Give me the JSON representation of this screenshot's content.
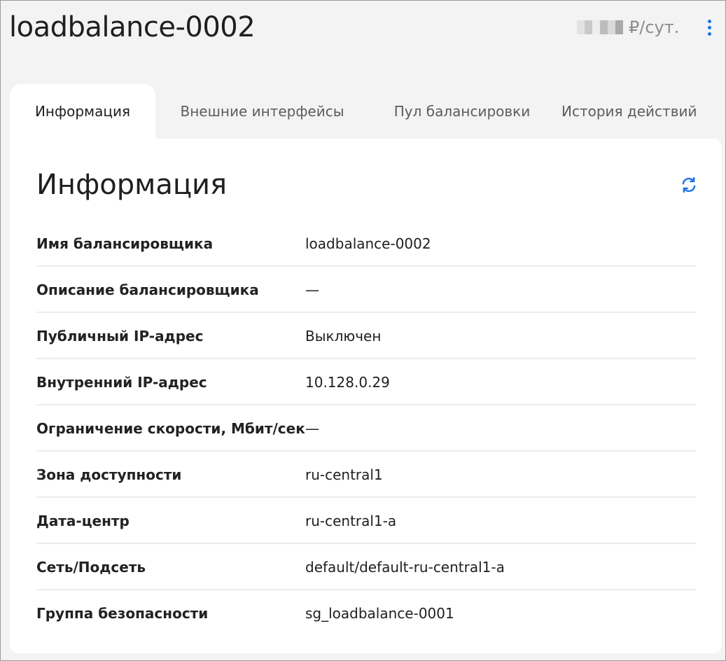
{
  "header": {
    "title": "loadbalance-0002",
    "price_unit": "₽/сут.",
    "menu_icon": "kebab-menu-icon"
  },
  "tabs": [
    {
      "label": "Информация",
      "active": true
    },
    {
      "label": "Внешние интерфейсы",
      "active": false
    },
    {
      "label": "Пул балансировки",
      "active": false
    },
    {
      "label": "История действий",
      "active": false
    }
  ],
  "section": {
    "title": "Информация",
    "refresh_icon": "refresh-icon"
  },
  "details": [
    {
      "label": "Имя балансировщика",
      "value": "loadbalance-0002"
    },
    {
      "label": "Описание балансировщика",
      "value": "—"
    },
    {
      "label": "Публичный IP-адрес",
      "value": "Выключен"
    },
    {
      "label": "Внутренний IP-адрес",
      "value": "10.128.0.29"
    },
    {
      "label": "Ограничение скорости, Мбит/сек",
      "value": "—"
    },
    {
      "label": "Зона доступности",
      "value": "ru-central1"
    },
    {
      "label": "Дата-центр",
      "value": "ru-central1-a"
    },
    {
      "label": "Сеть/Подсеть",
      "value": "default/default-ru-central1-a"
    },
    {
      "label": "Группа безопасности",
      "value": "sg_loadbalance-0001"
    }
  ],
  "colors": {
    "accent": "#1a73e8",
    "background": "#f3f3f3",
    "panel": "#ffffff",
    "muted_text": "#8c8c8c"
  }
}
